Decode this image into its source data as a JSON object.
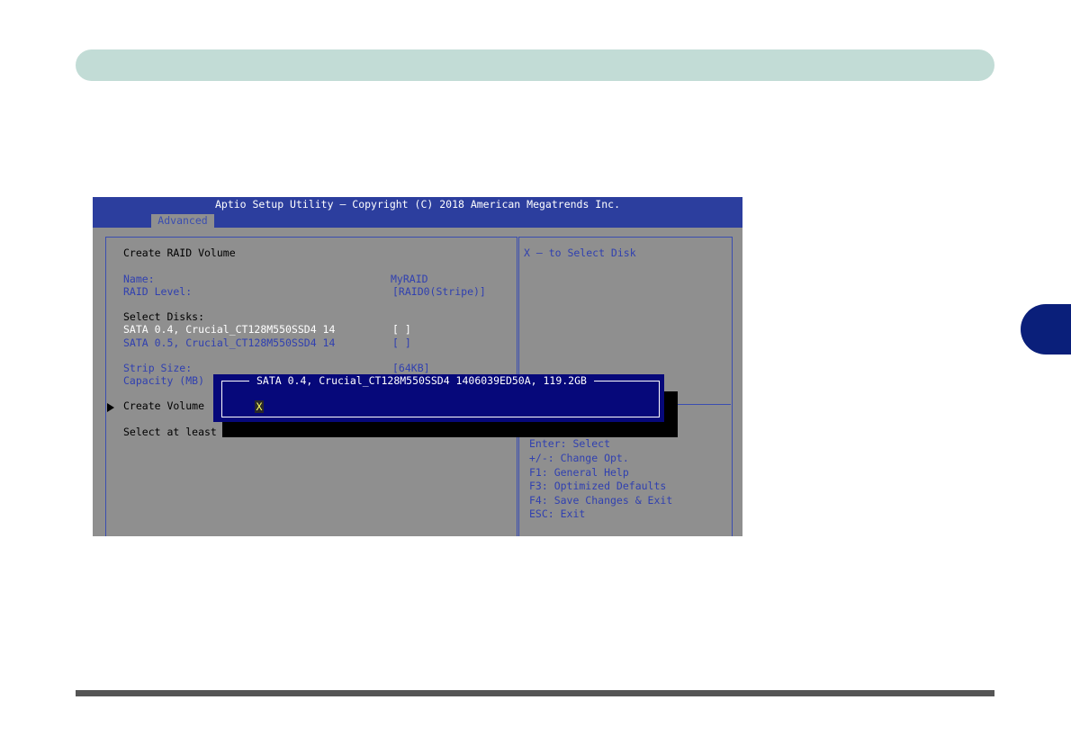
{
  "bios": {
    "title": "Aptio Setup Utility – Copyright (C) 2018 American Megatrends Inc.",
    "active_tab": "Advanced",
    "section_title": "Create RAID Volume",
    "name_label": "Name:",
    "name_value": "MyRAID",
    "raid_level_label": "RAID Level:",
    "raid_level_value": "[RAID0(Stripe)]",
    "select_disks_label": "Select Disks:",
    "disks": [
      {
        "label": "SATA 0.4, Crucial_CT128M550SSD4 14",
        "value": "[ ]"
      },
      {
        "label": "SATA 0.5, Crucial_CT128M550SSD4 14",
        "value": "[ ]"
      }
    ],
    "strip_size_label": "Strip Size:",
    "strip_size_value": "[64KB]",
    "capacity_label": "Capacity (MB)",
    "create_volume_label": "Create Volume",
    "select_hint": "Select at least two",
    "help_text": "X – to Select Disk",
    "keys": [
      "Enter: Select",
      "+/-: Change Opt.",
      "F1: General Help",
      "F3: Optimized Defaults",
      "F4: Save Changes & Exit",
      "ESC: Exit"
    ],
    "popup": {
      "title": "SATA 0.4, Crucial_CT128M550SSD4 1406039ED50A, 119.2GB",
      "option": "X"
    }
  },
  "colors": {
    "header_bar": "#c2dcd6",
    "chapter_tab": "#0a1f7a",
    "bios_header": "#2c3e9e",
    "bios_background": "#8f8f8f",
    "popup_background": "#06087a"
  }
}
